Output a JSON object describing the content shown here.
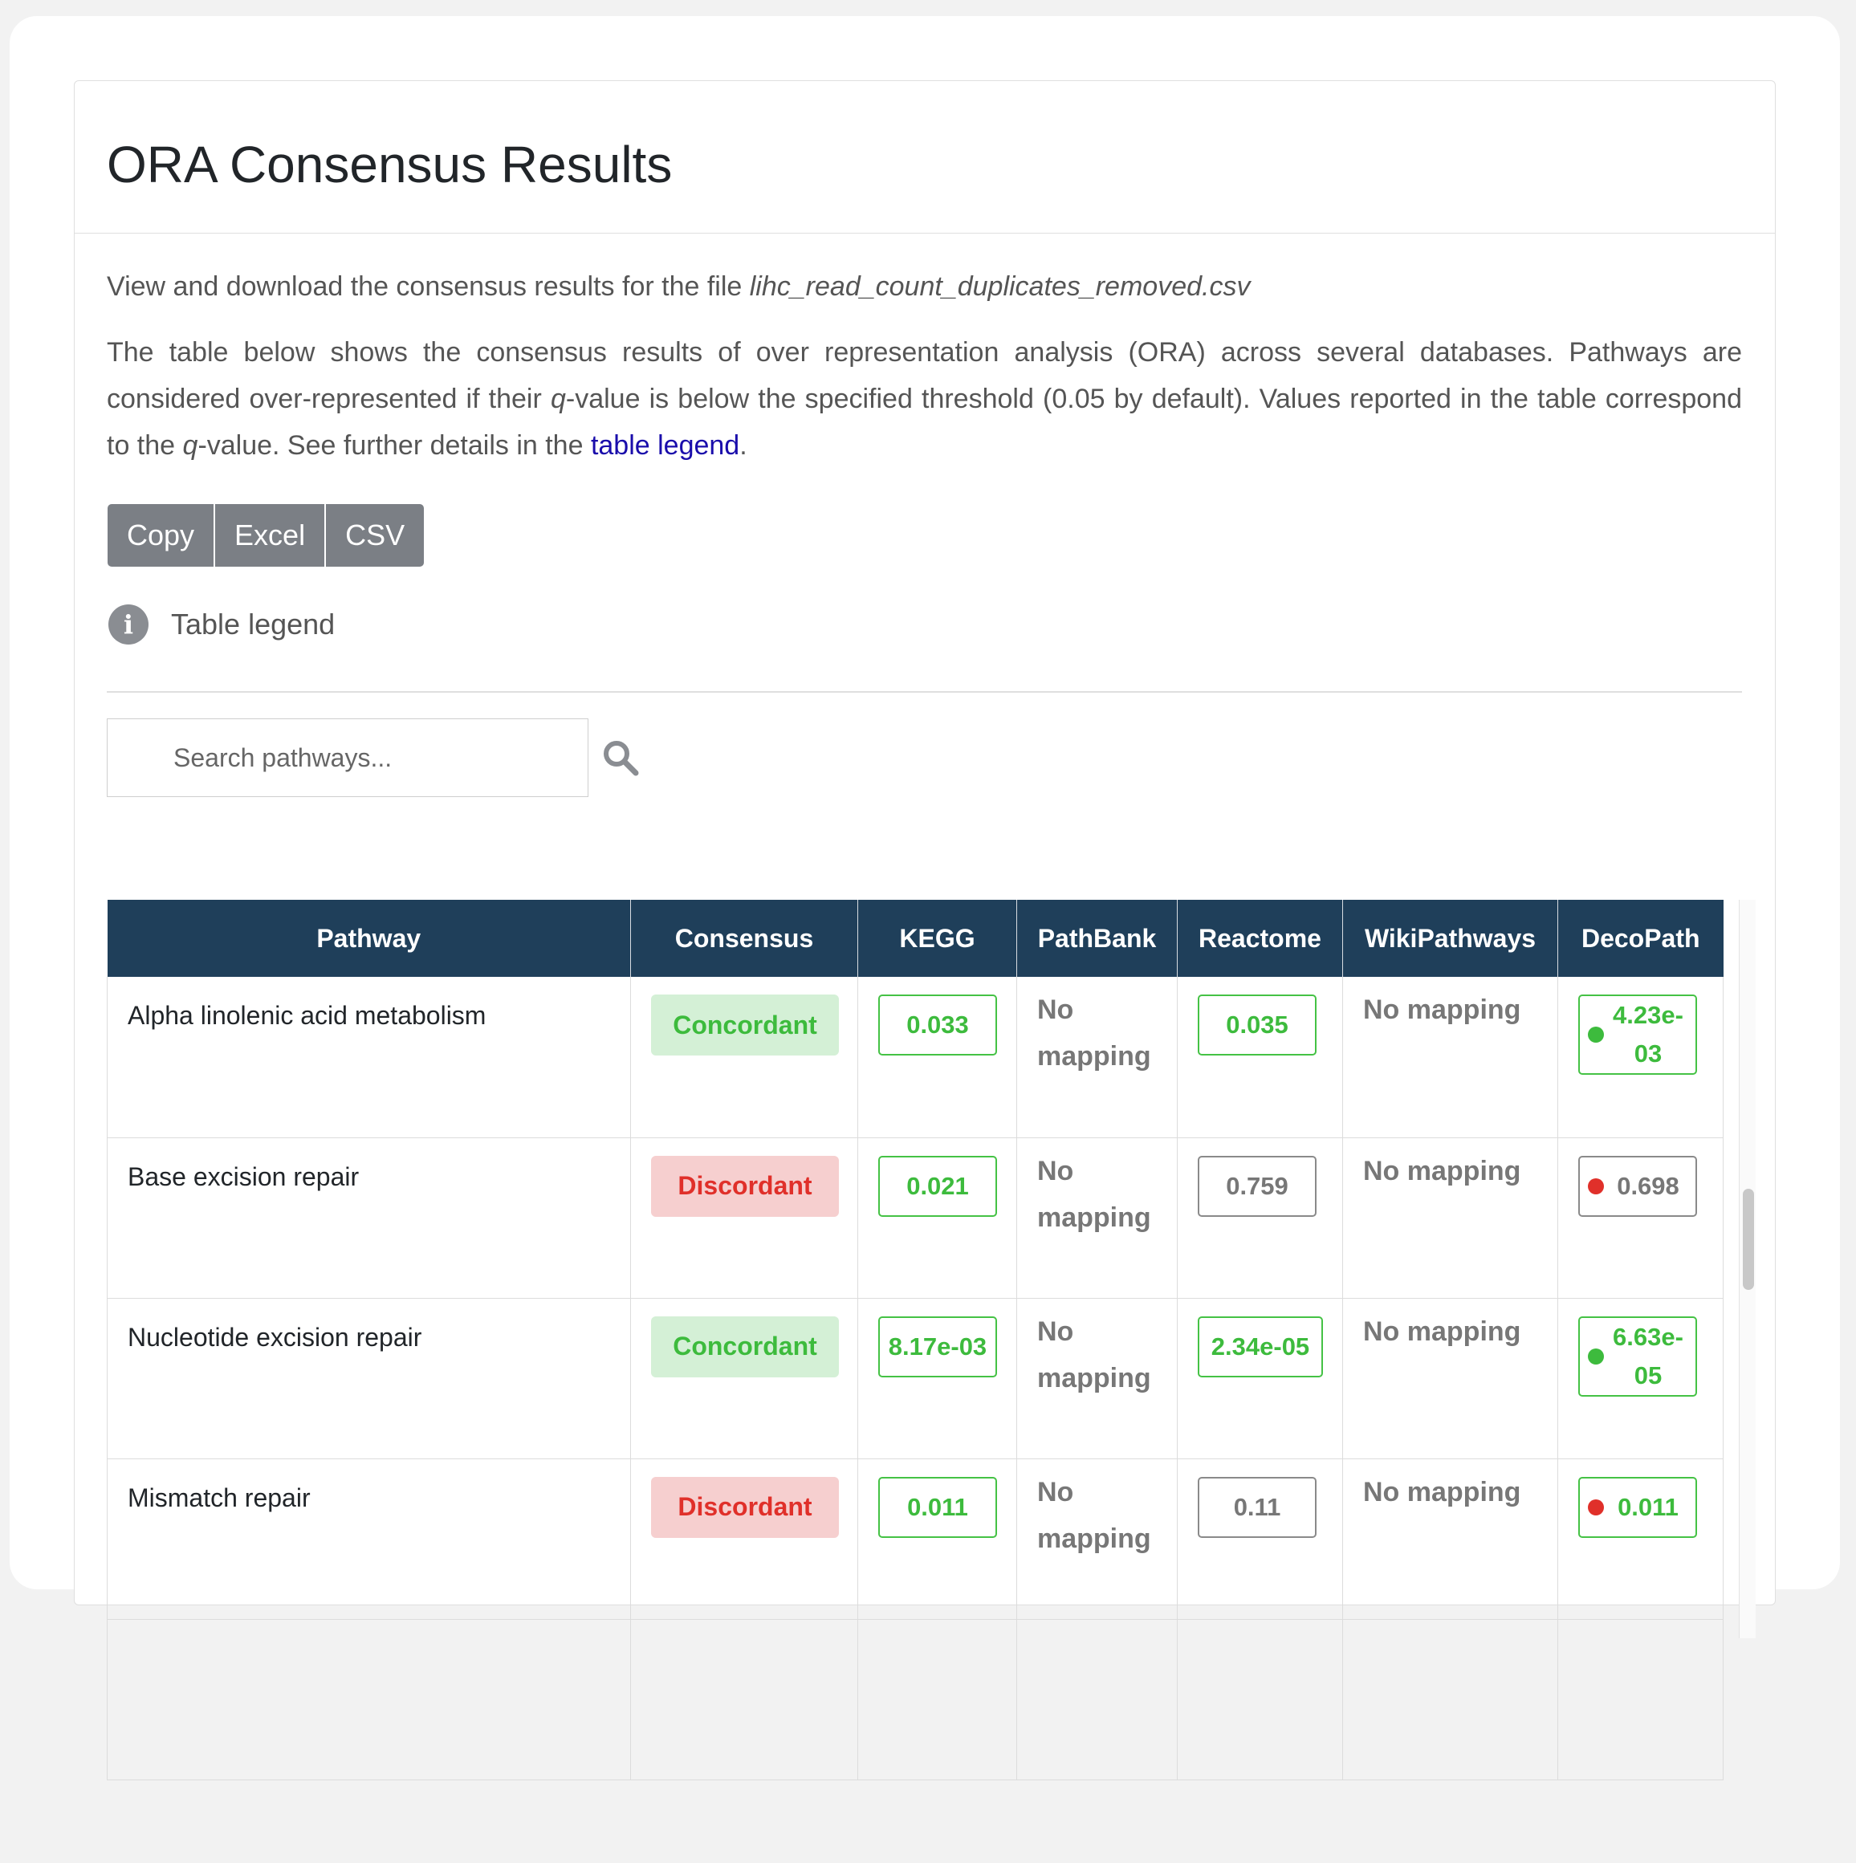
{
  "card": {
    "title": "ORA Consensus Results"
  },
  "intro": {
    "prefix": "View and download the consensus results for the file ",
    "filename": "lihc_read_count_duplicates_removed.csv"
  },
  "description": {
    "part1": "The table below shows the consensus results of over representation analysis (ORA) across several databases. Pathways are considered over-represented if their ",
    "q1": "q",
    "part2": "-value is below the specified threshold (0.05 by default). Values reported in the table correspond to the ",
    "q2": "q",
    "part3": "-value. See further details in the ",
    "link": "table legend",
    "part4": "."
  },
  "buttons": {
    "copy": "Copy",
    "excel": "Excel",
    "csv": "CSV"
  },
  "legend": {
    "icon": "info-icon",
    "label": "Table legend"
  },
  "search": {
    "placeholder": "Search pathways...",
    "icon": "search-icon"
  },
  "table": {
    "headers": [
      "Pathway",
      "Consensus",
      "KEGG",
      "PathBank",
      "Reactome",
      "WikiPathways",
      "DecoPath"
    ],
    "rows": [
      {
        "pathway": "Alpha linolenic acid metabolism",
        "consensus": "Concordant",
        "kegg": "0.033",
        "pathbank": "No mapping",
        "reactome": "0.035",
        "wikipathways": "No mapping",
        "decopath": "4.23e-03"
      },
      {
        "pathway": "Base excision repair",
        "consensus": "Discordant",
        "kegg": "0.021",
        "pathbank": "No mapping",
        "reactome": "0.759",
        "wikipathways": "No mapping",
        "decopath": "0.698"
      },
      {
        "pathway": "Nucleotide excision repair",
        "consensus": "Concordant",
        "kegg": "8.17e-03",
        "pathbank": "No mapping",
        "reactome": "2.34e-05",
        "wikipathways": "No mapping",
        "decopath": "6.63e-05"
      },
      {
        "pathway": "Mismatch repair",
        "consensus": "Discordant",
        "kegg": "0.011",
        "pathbank": "No mapping",
        "reactome": "0.11",
        "wikipathways": "No mapping",
        "decopath": "0.011"
      }
    ]
  },
  "colors": {
    "header_bg": "#1f3f5a",
    "concordant_text": "#3dbb3d",
    "concordant_bg": "#d4f0d6",
    "discordant_text": "#e0302a",
    "discordant_bg": "#f6cfcf",
    "significant_border": "#45c245",
    "nonsignificant_border": "#8a8a8a",
    "link": "#1a0dab",
    "button_bg": "#7b7f85"
  }
}
